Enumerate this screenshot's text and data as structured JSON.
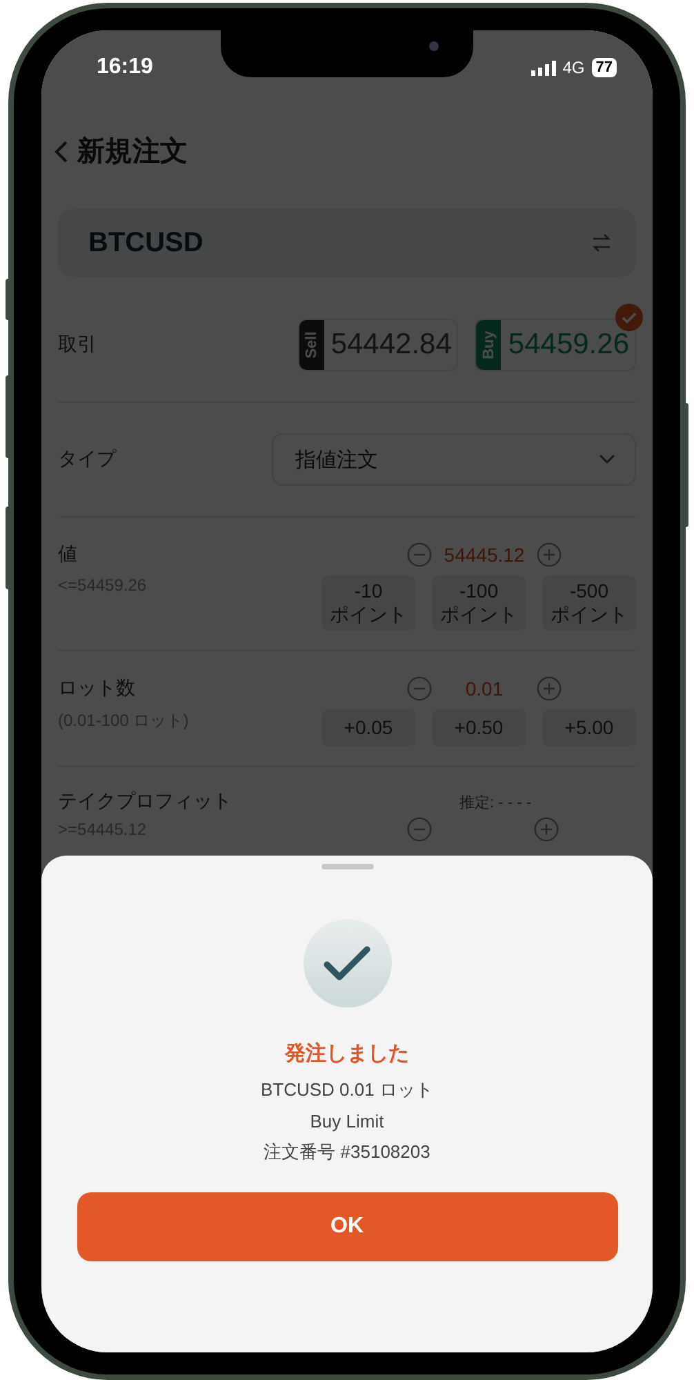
{
  "status_bar": {
    "time": "16:19",
    "network": "4G",
    "battery": "77"
  },
  "header": {
    "title": "新規注文"
  },
  "symbol": {
    "name": "BTCUSD"
  },
  "trade": {
    "label": "取引",
    "options": [
      {
        "side": "Sell",
        "price": "54442.84",
        "selected": false
      },
      {
        "side": "Buy",
        "price": "54459.26",
        "selected": true
      }
    ]
  },
  "order_type": {
    "label": "タイプ",
    "value": "指値注文"
  },
  "price": {
    "label": "値",
    "value": "54445.12",
    "hint": "<=54459.26",
    "steps": [
      {
        "amount": "-10",
        "unit": "ポイント"
      },
      {
        "amount": "-100",
        "unit": "ポイント"
      },
      {
        "amount": "-500",
        "unit": "ポイント"
      }
    ]
  },
  "lots": {
    "label": "ロット数",
    "value": "0.01",
    "hint": "(0.01-100 ロット)",
    "steps": [
      {
        "amount": "+0.05"
      },
      {
        "amount": "+0.50"
      },
      {
        "amount": "+5.00"
      }
    ]
  },
  "take_profit": {
    "label": "テイクプロフィット",
    "estimate": "推定: - - - -",
    "hint": ">=54445.12"
  },
  "dialog": {
    "title": "発注しました",
    "lines": [
      "BTCUSD 0.01 ロット",
      "Buy Limit",
      "注文番号 #35108203"
    ],
    "button": "OK"
  }
}
